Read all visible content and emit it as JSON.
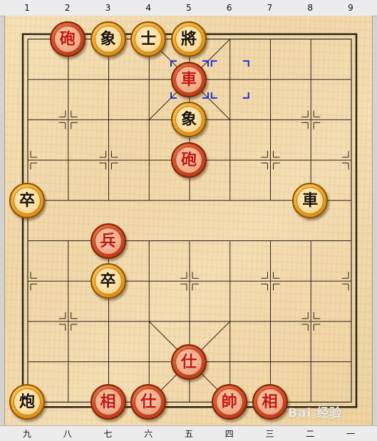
{
  "board": {
    "top_coords": [
      "1",
      "2",
      "3",
      "4",
      "5",
      "6",
      "7",
      "8",
      "9"
    ],
    "bottom_coords": [
      "九",
      "八",
      "七",
      "六",
      "五",
      "四",
      "三",
      "二",
      "一"
    ],
    "selection_markers": [
      {
        "file": 5,
        "rank": 1
      },
      {
        "file": 6,
        "rank": 1
      }
    ]
  },
  "pieces": [
    {
      "id": "black-cannon-top",
      "glyph": "砲",
      "side": "red",
      "file": 2,
      "rank": 0,
      "kind": "cannon"
    },
    {
      "id": "black-elephant-top",
      "glyph": "象",
      "side": "black",
      "file": 3,
      "rank": 0,
      "kind": "elephant"
    },
    {
      "id": "black-advisor-top",
      "glyph": "士",
      "side": "black",
      "file": 4,
      "rank": 0,
      "kind": "advisor"
    },
    {
      "id": "black-general",
      "glyph": "將",
      "side": "black",
      "file": 5,
      "rank": 0,
      "kind": "general"
    },
    {
      "id": "red-chariot-top",
      "glyph": "車",
      "side": "red",
      "file": 5,
      "rank": 1,
      "kind": "chariot"
    },
    {
      "id": "black-elephant-mid",
      "glyph": "象",
      "side": "black",
      "file": 5,
      "rank": 2,
      "kind": "elephant"
    },
    {
      "id": "red-cannon-mid",
      "glyph": "砲",
      "side": "red",
      "file": 5,
      "rank": 3,
      "kind": "cannon"
    },
    {
      "id": "black-soldier-left",
      "glyph": "卒",
      "side": "black",
      "file": 1,
      "rank": 4,
      "kind": "soldier"
    },
    {
      "id": "black-chariot-right",
      "glyph": "車",
      "side": "black",
      "file": 8,
      "rank": 4,
      "kind": "chariot"
    },
    {
      "id": "red-soldier",
      "glyph": "兵",
      "side": "red",
      "file": 3,
      "rank": 5,
      "kind": "soldier"
    },
    {
      "id": "black-soldier-mid",
      "glyph": "卒",
      "side": "black",
      "file": 3,
      "rank": 6,
      "kind": "soldier"
    },
    {
      "id": "red-advisor-mid",
      "glyph": "仕",
      "side": "red",
      "file": 5,
      "rank": 8,
      "kind": "advisor"
    },
    {
      "id": "black-cannon-bottom",
      "glyph": "炮",
      "side": "black",
      "file": 1,
      "rank": 9,
      "kind": "cannon"
    },
    {
      "id": "red-elephant-left",
      "glyph": "相",
      "side": "red",
      "file": 3,
      "rank": 9,
      "kind": "elephant"
    },
    {
      "id": "red-advisor-bottom",
      "glyph": "仕",
      "side": "red",
      "file": 4,
      "rank": 9,
      "kind": "advisor"
    },
    {
      "id": "red-general",
      "glyph": "帥",
      "side": "red",
      "file": 6,
      "rank": 9,
      "kind": "general"
    },
    {
      "id": "red-elephant-right",
      "glyph": "相",
      "side": "red",
      "file": 7,
      "rank": 9,
      "kind": "elephant"
    }
  ],
  "watermark": {
    "text": "Bai 经验"
  },
  "colors": {
    "board": "#efd6a6",
    "lines": "#2b2216",
    "selection": "#1f2fd6",
    "red_piece": "#d9512a",
    "black_piece": "#f1ac2e"
  }
}
